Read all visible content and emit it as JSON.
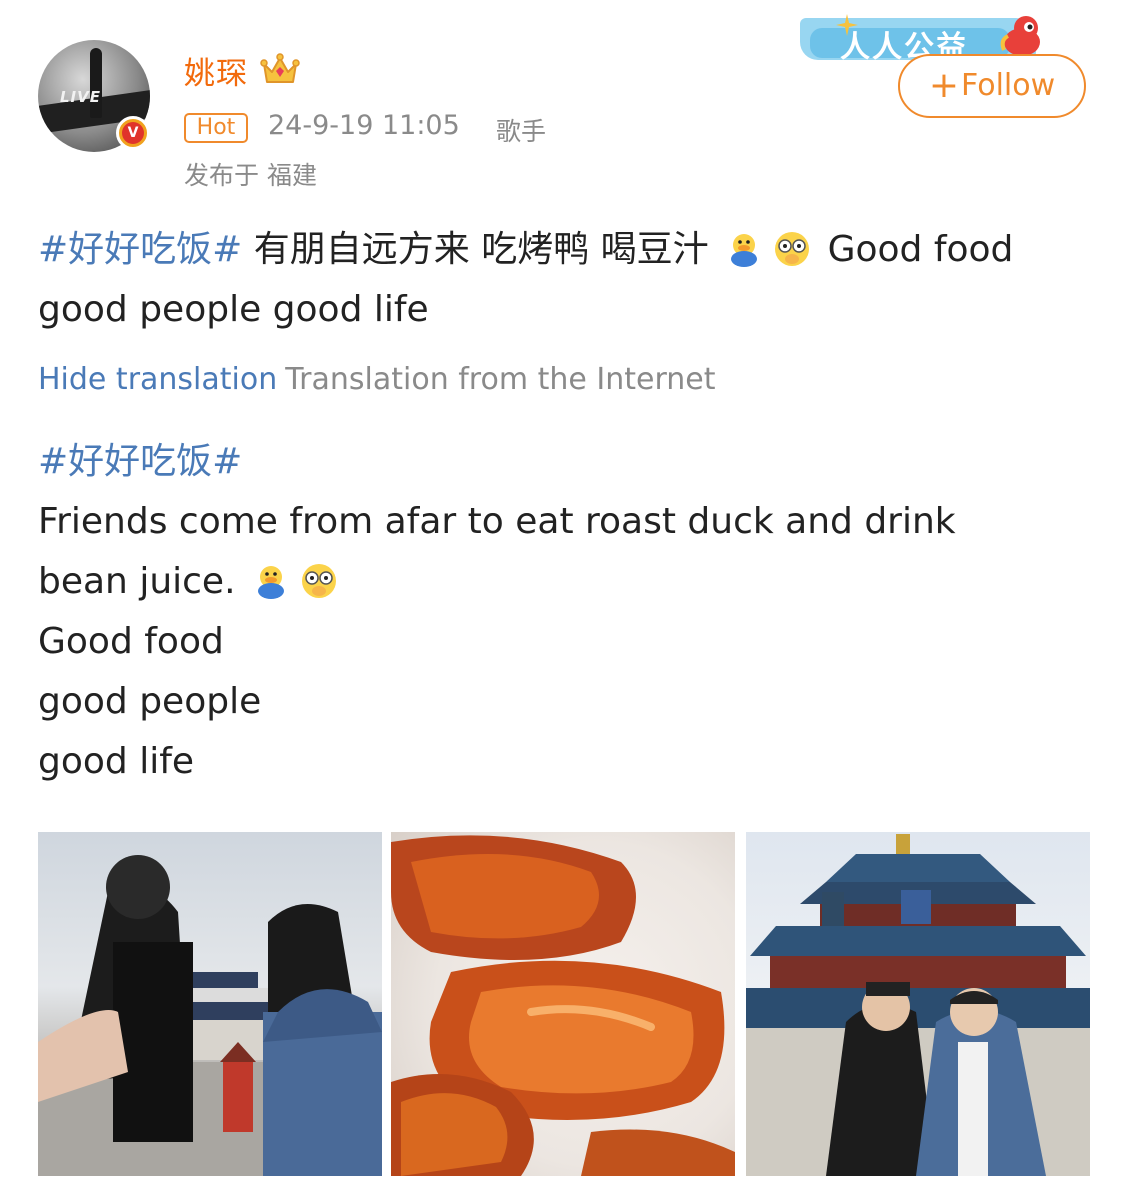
{
  "user": {
    "name": "姚琛",
    "badge_hot": "Hot",
    "timestamp": "24-9-19 11:05",
    "role": "歌手",
    "location": "发布于 福建",
    "verified_icon": "v-verified-icon",
    "crown_icon": "crown-icon",
    "avatar_logo": "LIVE"
  },
  "campaign_badge": {
    "text": "人人公益"
  },
  "follow_button": {
    "plus": "+",
    "label": "Follow"
  },
  "post": {
    "hashtag": "#好好吃饭#",
    "text_cn": " 有朋自远方来 吃烤鸭 喝豆汁",
    "text_en_tail": "Good food",
    "line2": "good people  good life"
  },
  "translation": {
    "hide_label": "Hide translation",
    "source_label": "Translation from the Internet",
    "hashtag": "#好好吃饭#",
    "line1": "Friends come from afar to eat roast duck and drink",
    "line2": "bean juice.",
    "line3": "Good food",
    "line4": "good people",
    "line5": "good life"
  },
  "images": [
    {
      "subject": "two-people-at-temple-of-heaven"
    },
    {
      "subject": "roast-duck"
    },
    {
      "subject": "two-people-posing-at-temple"
    }
  ],
  "colors": {
    "accent_orange": "#f08a2c",
    "username_orange": "#f26a0c",
    "link_blue": "#4a7ab7",
    "meta_gray": "#8a8a8a"
  }
}
